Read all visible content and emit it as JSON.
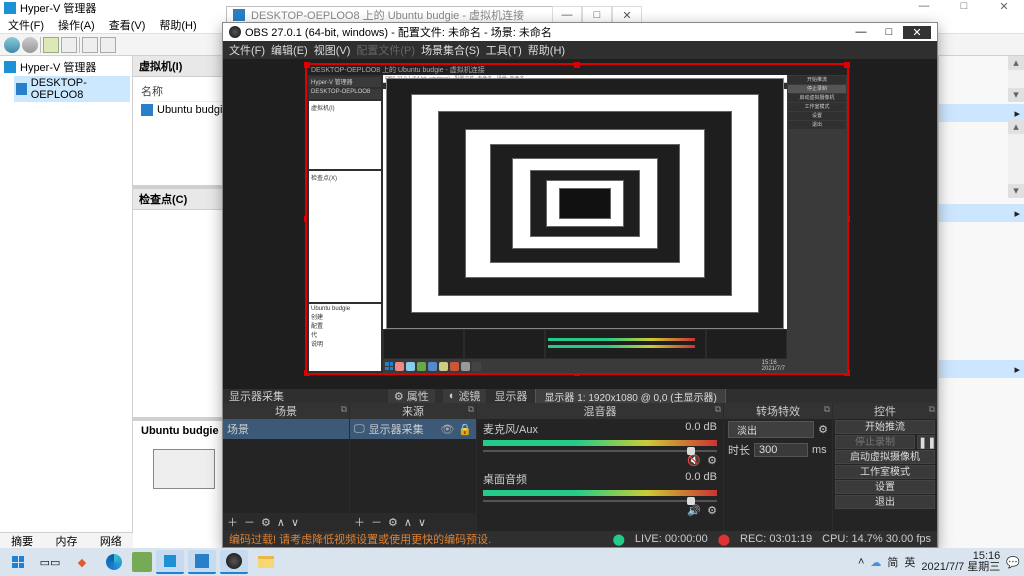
{
  "hyperv": {
    "title": "Hyper-V 管理器",
    "menu": [
      "文件(F)",
      "操作(A)",
      "查看(V)",
      "帮助(H)"
    ],
    "tree": {
      "root": "Hyper-V 管理器",
      "node": "DESKTOP-OEPLOO8"
    },
    "vm_panel_hdr": "虚拟机(I)",
    "vm_col_name": "名称",
    "vm_name": "Ubuntu budgie",
    "chk_hdr": "检查点(C)",
    "section_label": "Ubuntu budgie",
    "detail_lines": [
      "创建",
      "配置",
      "代数",
      "说明"
    ],
    "bottom_tabs": [
      "摘要",
      "内存",
      "网络"
    ]
  },
  "vmconnect": {
    "title": "DESKTOP-OEPLOO8 上的 Ubuntu budgie - 虚拟机连接"
  },
  "obs": {
    "title": "OBS 27.0.1 (64-bit, windows) - 配置文件: 未命名 - 场景: 未命名",
    "menu": [
      "文件(F)",
      "编辑(E)",
      "视图(V)",
      "配置文件(P)",
      "场景集合(S)",
      "工具(T)",
      "帮助(H)"
    ],
    "sep": {
      "label_left": "显示器采集",
      "prop": "属性",
      "filter": "滤镜",
      "display_lbl": "显示器",
      "display_val": "显示器 1: 1920x1080 @ 0,0 (主显示器)"
    },
    "docks": {
      "scenes": {
        "hdr": "场景",
        "item": "场景"
      },
      "sources": {
        "hdr": "来源",
        "item": "显示器采集"
      },
      "mixer": {
        "hdr": "混音器",
        "ch1": {
          "name": "麦克风/Aux",
          "db": "0.0 dB"
        },
        "ch2": {
          "name": "桌面音频",
          "db": "0.0 dB"
        }
      },
      "trans": {
        "hdr": "转场特效",
        "fade": "淡出",
        "dur_lbl": "时长",
        "dur_val": "300",
        "dur_unit": "ms"
      },
      "ctrl": {
        "hdr": "控件",
        "start_stream": "开始推流",
        "stop_rec": "停止录制",
        "virtual_cam": "启动虚拟摄像机",
        "studio": "工作室模式",
        "settings": "设置",
        "exit": "退出"
      }
    },
    "status": {
      "warn": "编码过载! 请考虑降低视频设置或使用更快的编码预设.",
      "live": "LIVE: 00:00:00",
      "rec": "REC: 03:01:19",
      "cpu": "CPU: 14.7%  30.00 fps"
    }
  },
  "taskbar": {
    "tray": {
      "ime1": "简",
      "ime2": "英",
      "time": "15:16",
      "date": "2021/7/7 星期三"
    }
  }
}
